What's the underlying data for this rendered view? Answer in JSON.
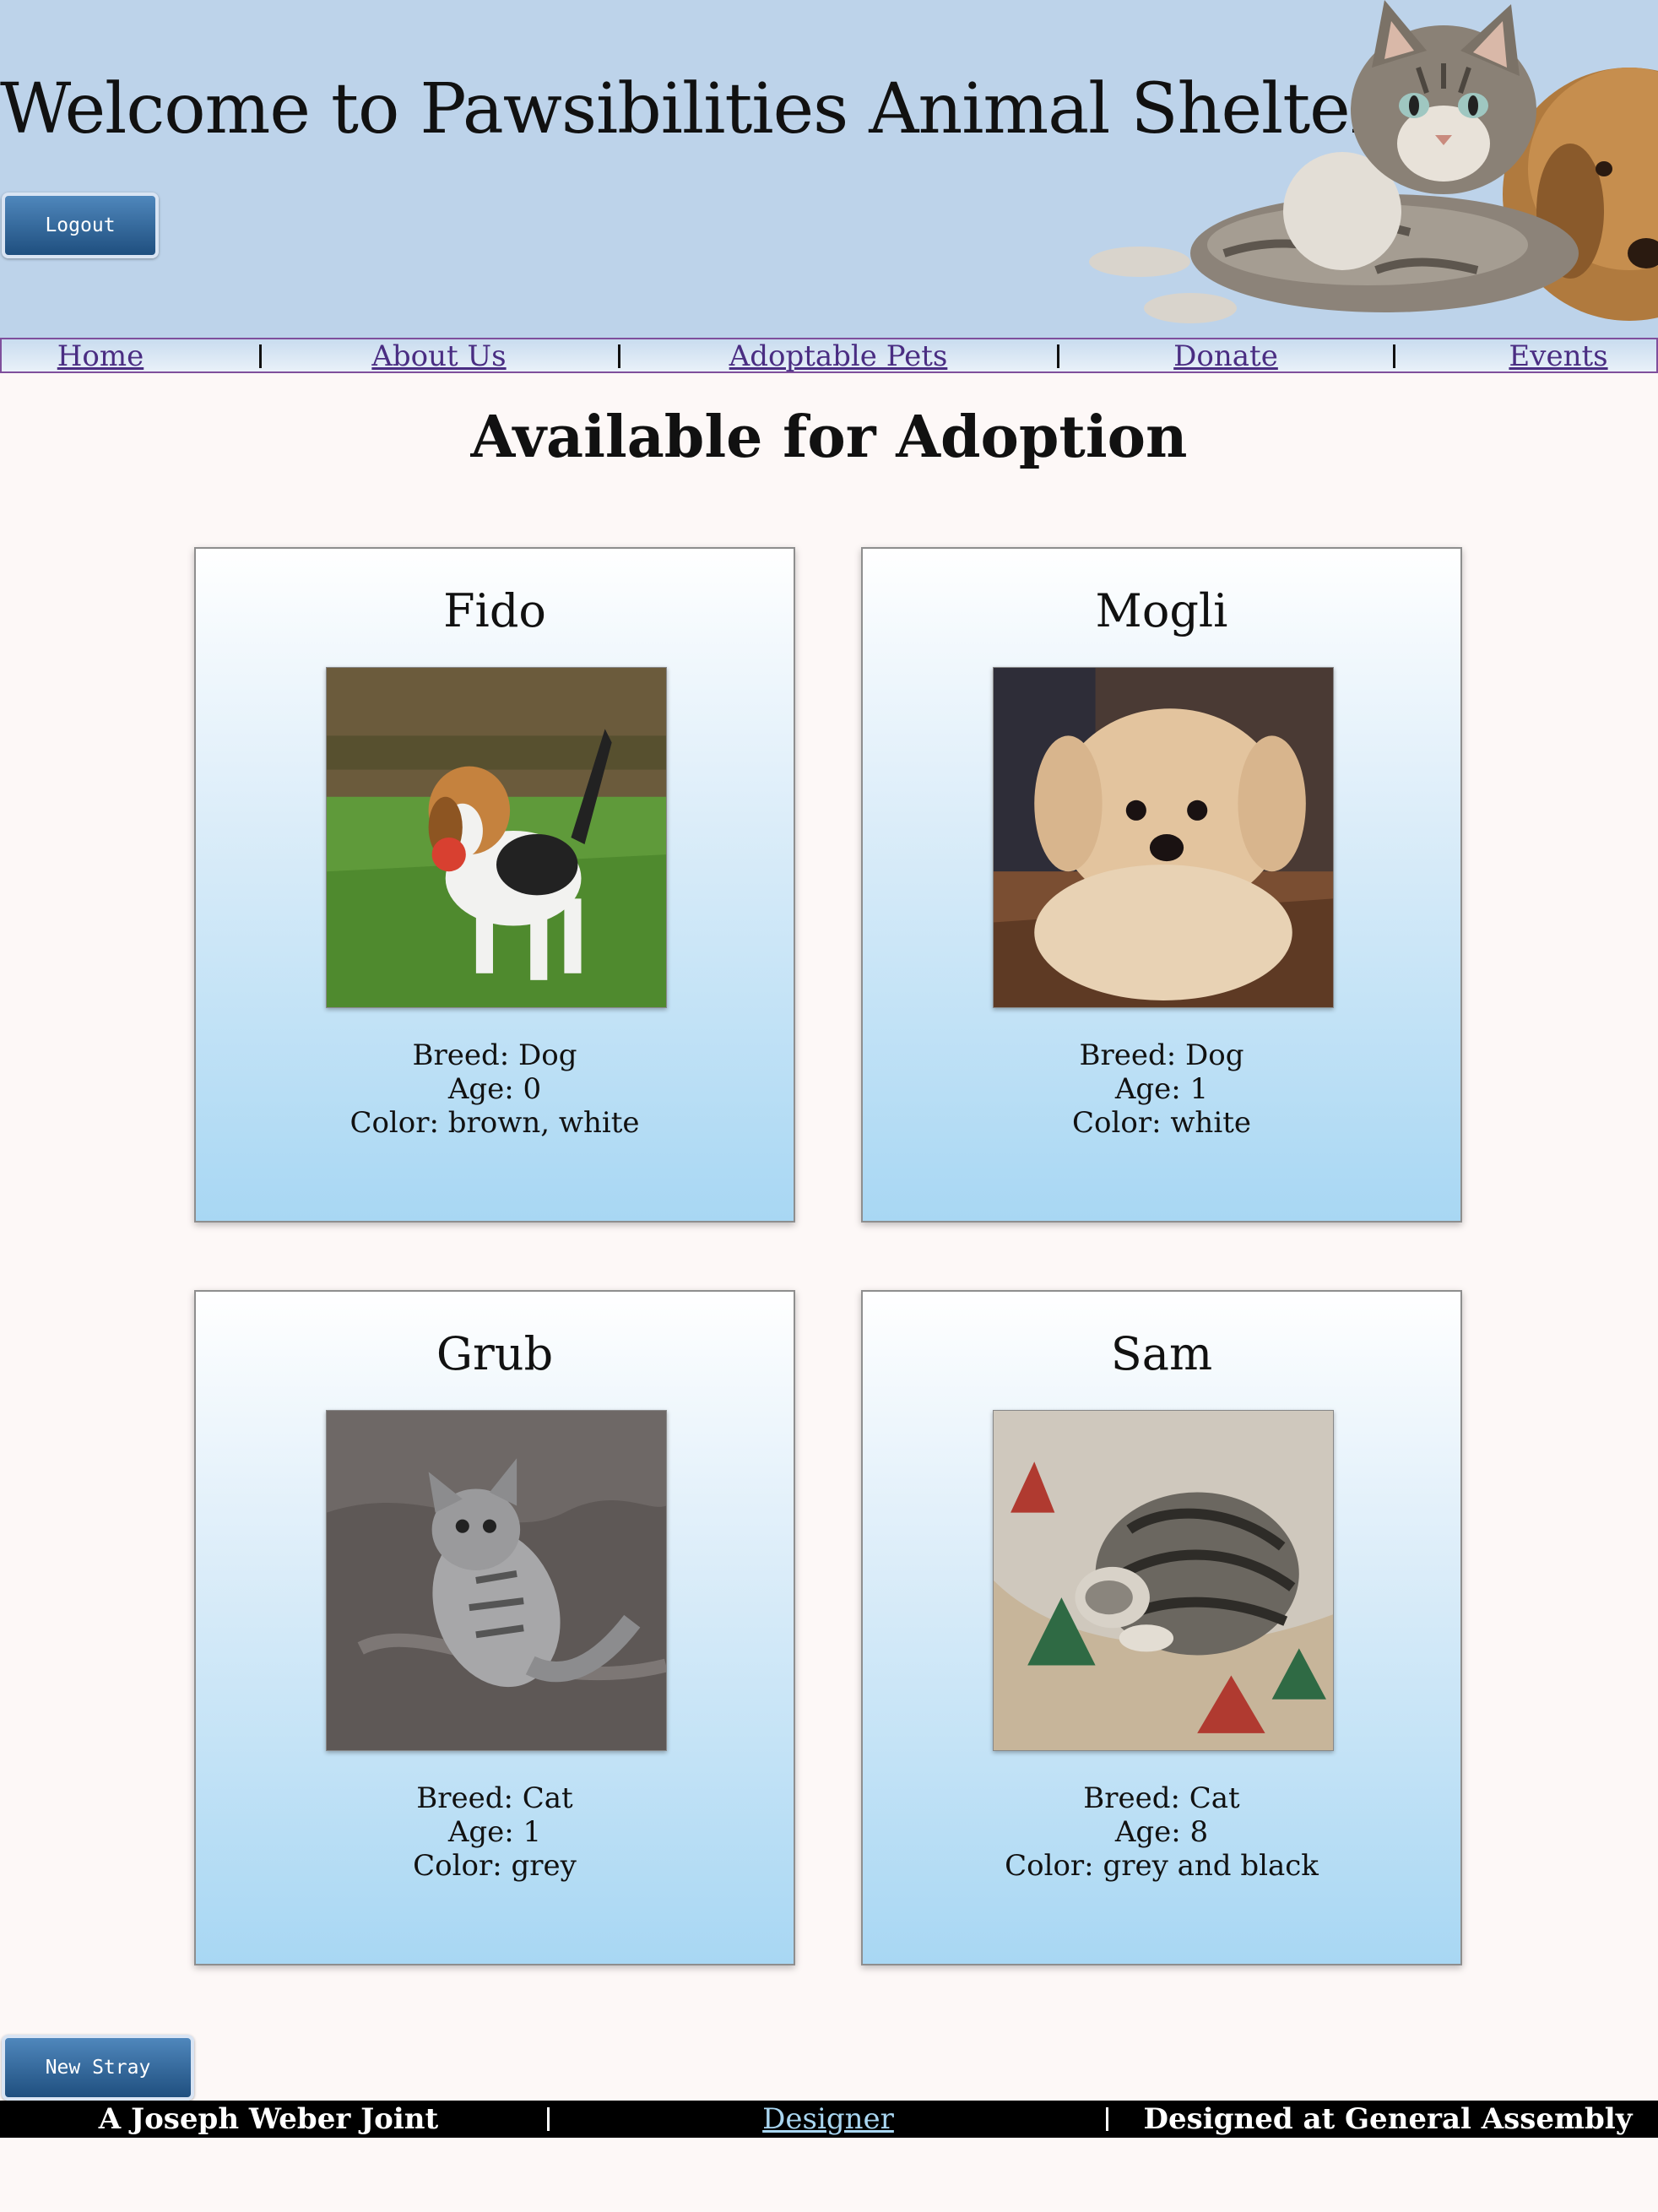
{
  "header": {
    "title": "Welcome to Pawsibilities Animal Shelter",
    "logout_label": "Logout"
  },
  "nav": {
    "items": [
      {
        "label": "Home"
      },
      {
        "label": "About Us"
      },
      {
        "label": "Adoptable Pets"
      },
      {
        "label": "Donate"
      },
      {
        "label": "Events"
      }
    ]
  },
  "main": {
    "heading": "Available for Adoption",
    "pets": [
      {
        "name": "Fido",
        "breed": "Breed: Dog",
        "age": "Age: 0",
        "color": "Color: brown, white",
        "photo_icon": "beagle-puppy-photo"
      },
      {
        "name": "Mogli",
        "breed": "Breed: Dog",
        "age": "Age: 1",
        "color": "Color: white",
        "photo_icon": "fluffy-puppy-photo"
      },
      {
        "name": "Grub",
        "breed": "Breed: Cat",
        "age": "Age: 1",
        "color": "Color: grey",
        "photo_icon": "grey-kitten-photo"
      },
      {
        "name": "Sam",
        "breed": "Breed: Cat",
        "age": "Age: 8",
        "color": "Color: grey and black",
        "photo_icon": "tabby-cat-photo"
      }
    ],
    "new_stray_label": "New Stray"
  },
  "footer": {
    "left": "A Joseph Weber Joint",
    "middle_link": "Designer",
    "right": "Designed at General Assembly"
  },
  "colors": {
    "header_bg": "#bdd3ea",
    "page_bg": "#fdf8f7",
    "button_top": "#4f87bc",
    "button_bottom": "#1f4f7f",
    "nav_link": "#4a2d82",
    "card_gradient_bottom": "#a8d7f3",
    "footer_bg": "#000000",
    "footer_link": "#a9d6f1"
  }
}
